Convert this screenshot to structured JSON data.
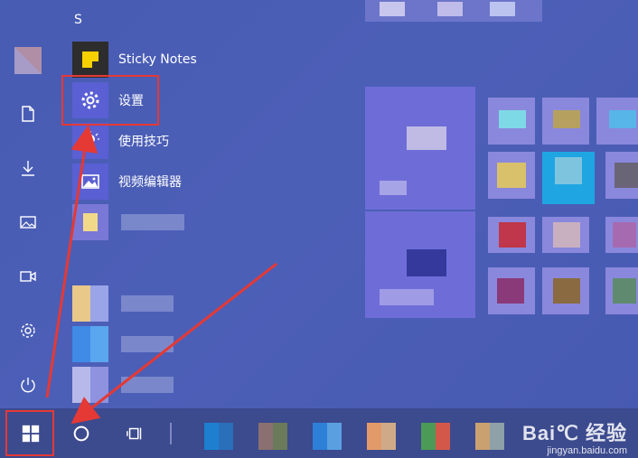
{
  "start_menu": {
    "letter_header": "S",
    "apps": [
      {
        "label": "Sticky Notes",
        "icon": "sticky-notes-icon"
      },
      {
        "label": "设置",
        "icon": "gear-icon"
      },
      {
        "label": "使用技巧",
        "icon": "lightbulb-icon"
      },
      {
        "label": "视频编辑器",
        "icon": "video-editor-icon"
      }
    ]
  },
  "rail": {
    "items": [
      "user-avatar",
      "documents-icon",
      "downloads-icon",
      "pictures-icon",
      "videos-icon",
      "settings-icon",
      "power-icon"
    ]
  },
  "taskbar": {
    "buttons": [
      "windows-start-icon",
      "cortana-search-icon",
      "task-view-icon"
    ]
  },
  "watermark": {
    "main": "Bai℃ 经验",
    "sub": "jingyan.baidu.com"
  },
  "colors": {
    "annotation": "#e53935",
    "accent": "#5a5fd3"
  }
}
